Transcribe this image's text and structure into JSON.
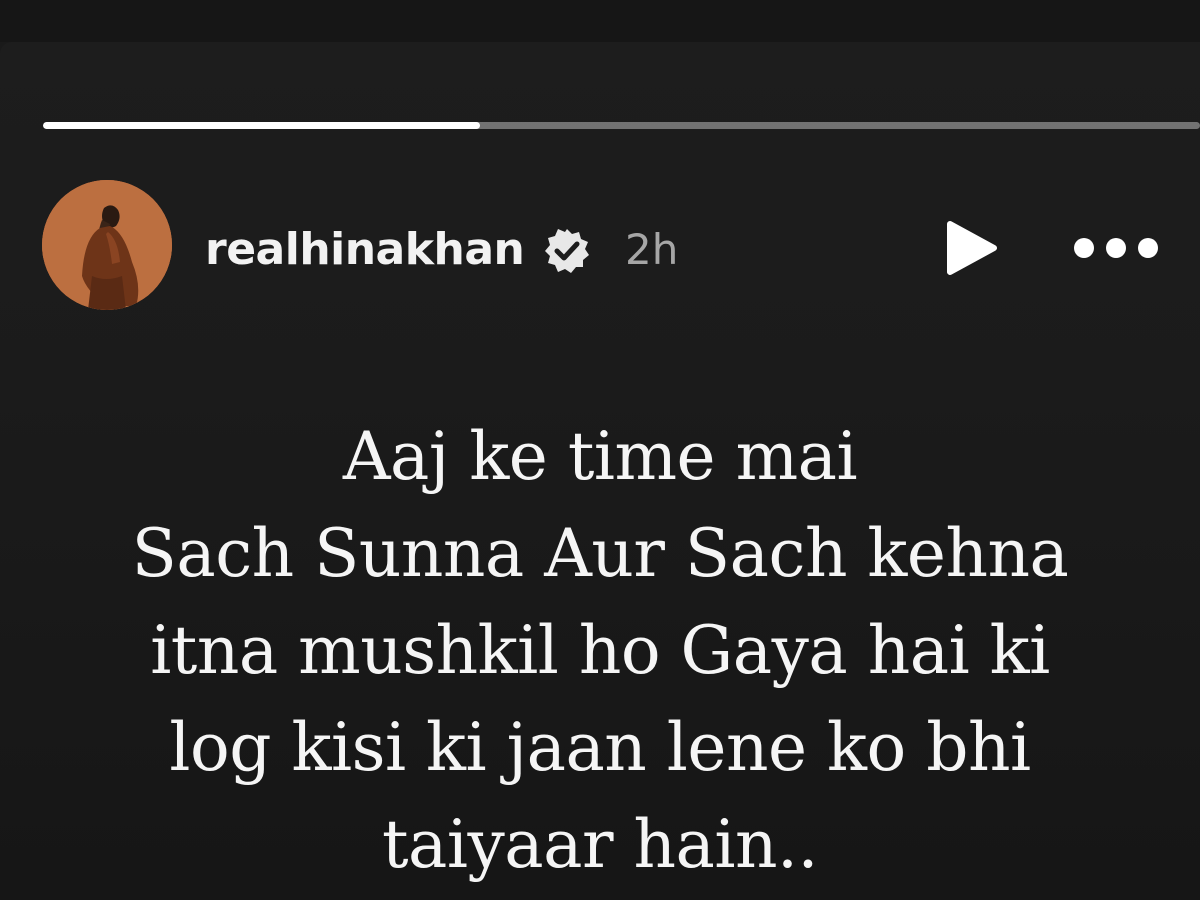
{
  "story": {
    "progress_fraction": 0.378,
    "account": {
      "username": "realhinakhan",
      "verified": true,
      "time_ago": "2h"
    },
    "text_lines": [
      "Aaj ke time mai",
      "Sach Sunna Aur Sach kehna",
      "itna mushkil ho Gaya hai ki",
      "log kisi ki jaan lene ko bhi",
      "taiyaar hain.."
    ]
  },
  "icons": {
    "verified": "verified-badge-icon",
    "play": "play-icon",
    "more": "more-horizontal-icon"
  },
  "colors": {
    "background": "#1a1a1a",
    "text": "#f5f5f5",
    "muted": "#a6a6a6",
    "avatar": "#b3653a"
  }
}
